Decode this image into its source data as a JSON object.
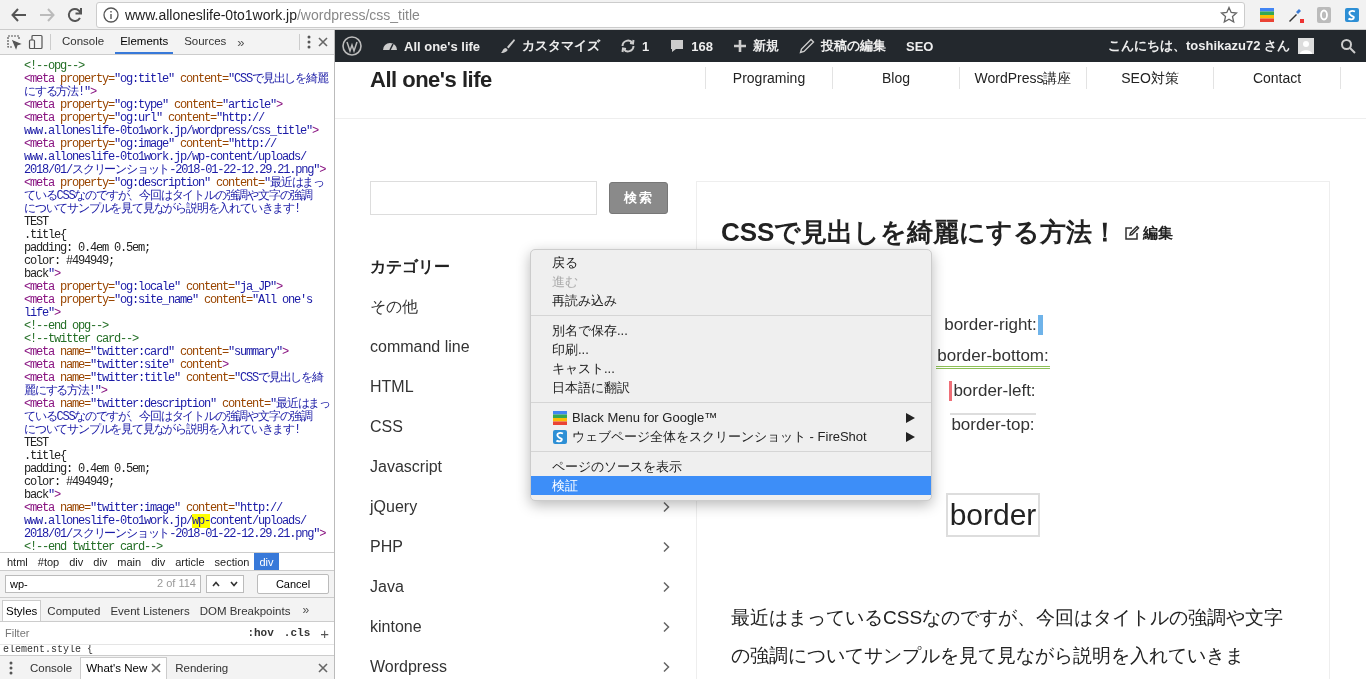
{
  "browser": {
    "url_host": "www.alloneslife-0to1work.jp",
    "url_path": "/wordpress/css_title",
    "back_disabled": false,
    "forward_disabled": true
  },
  "devtools": {
    "tabs": [
      {
        "label": "Console",
        "selected": false
      },
      {
        "label": "Elements",
        "selected": true
      },
      {
        "label": "Sources",
        "selected": false
      }
    ],
    "more": "»",
    "code_lines": [
      [
        {
          "kind": "comment",
          "text": "<!--opg-->"
        }
      ],
      [
        {
          "kind": "tag",
          "text": "<meta "
        },
        {
          "kind": "attr",
          "text": "property="
        },
        {
          "kind": "value",
          "text": "\"og:title\" "
        },
        {
          "kind": "attr",
          "text": "content="
        },
        {
          "kind": "value",
          "text": "\"CSSで見出しを綺麗"
        }
      ],
      [
        {
          "kind": "value",
          "text": "にする方法!\""
        },
        {
          "kind": "tag",
          "text": ">"
        }
      ],
      [
        {
          "kind": "tag",
          "text": "<meta "
        },
        {
          "kind": "attr",
          "text": "property="
        },
        {
          "kind": "value",
          "text": "\"og:type\" "
        },
        {
          "kind": "attr",
          "text": "content="
        },
        {
          "kind": "value",
          "text": "\"article\""
        },
        {
          "kind": "tag",
          "text": ">"
        }
      ],
      [
        {
          "kind": "tag",
          "text": "<meta "
        },
        {
          "kind": "attr",
          "text": "property="
        },
        {
          "kind": "value",
          "text": "\"og:url\" "
        },
        {
          "kind": "attr",
          "text": "content="
        },
        {
          "kind": "value",
          "text": "\"http://"
        }
      ],
      [
        {
          "kind": "value",
          "text": "www.alloneslife-0to1work.jp/wordpress/css_title\""
        },
        {
          "kind": "tag",
          "text": ">"
        }
      ],
      [
        {
          "kind": "tag",
          "text": "<meta "
        },
        {
          "kind": "attr",
          "text": "property="
        },
        {
          "kind": "value",
          "text": "\"og:image\" "
        },
        {
          "kind": "attr",
          "text": "content="
        },
        {
          "kind": "value",
          "text": "\"http://"
        }
      ],
      [
        {
          "kind": "value",
          "text": "www.alloneslife-0to1work.jp/wp-content/uploads/"
        }
      ],
      [
        {
          "kind": "value",
          "text": "2018/01/スクリーンショット-2018-01-22-12.29.21.png\""
        },
        {
          "kind": "tag",
          "text": ">"
        }
      ],
      [
        {
          "kind": "tag",
          "text": "<meta "
        },
        {
          "kind": "attr",
          "text": "property="
        },
        {
          "kind": "value",
          "text": "\"og:description\" "
        },
        {
          "kind": "attr",
          "text": "content="
        },
        {
          "kind": "value",
          "text": "\"最近はまっ"
        }
      ],
      [
        {
          "kind": "value",
          "text": "ているCSSなのですが、今回はタイトルの強調や文字の強調"
        }
      ],
      [
        {
          "kind": "value",
          "text": "についてサンプルを見て見ながら説明を入れていきます!"
        }
      ],
      [
        {
          "kind": "text",
          "text": "TEST"
        }
      ],
      [
        {
          "kind": "text",
          "text": ".title{"
        }
      ],
      [
        {
          "kind": "text",
          "text": "padding: 0.4em 0.5em;"
        }
      ],
      [
        {
          "kind": "text",
          "text": "color: #494949;"
        }
      ],
      [
        {
          "kind": "text",
          "text": "back"
        },
        {
          "kind": "value",
          "text": "\""
        },
        {
          "kind": "tag",
          "text": ">"
        }
      ],
      [
        {
          "kind": "tag",
          "text": "<meta "
        },
        {
          "kind": "attr",
          "text": "property="
        },
        {
          "kind": "value",
          "text": "\"og:locale\" "
        },
        {
          "kind": "attr",
          "text": "content="
        },
        {
          "kind": "value",
          "text": "\"ja_JP\""
        },
        {
          "kind": "tag",
          "text": ">"
        }
      ],
      [
        {
          "kind": "tag",
          "text": "<meta "
        },
        {
          "kind": "attr",
          "text": "property="
        },
        {
          "kind": "value",
          "text": "\"og:site_name\" "
        },
        {
          "kind": "attr",
          "text": "content="
        },
        {
          "kind": "value",
          "text": "\"All one's"
        }
      ],
      [
        {
          "kind": "value",
          "text": "life\""
        },
        {
          "kind": "tag",
          "text": ">"
        }
      ],
      [
        {
          "kind": "comment",
          "text": "<!--end opg-->"
        }
      ],
      [
        {
          "kind": "comment",
          "text": "<!--twitter card-->"
        }
      ],
      [
        {
          "kind": "tag",
          "text": "<meta "
        },
        {
          "kind": "attr",
          "text": "name="
        },
        {
          "kind": "value",
          "text": "\"twitter:card\" "
        },
        {
          "kind": "attr",
          "text": "content="
        },
        {
          "kind": "value",
          "text": "\"summary\""
        },
        {
          "kind": "tag",
          "text": ">"
        }
      ],
      [
        {
          "kind": "tag",
          "text": "<meta "
        },
        {
          "kind": "attr",
          "text": "name="
        },
        {
          "kind": "value",
          "text": "\"twitter:site\" "
        },
        {
          "kind": "attr",
          "text": "content"
        },
        {
          "kind": "tag",
          "text": ">"
        }
      ],
      [
        {
          "kind": "tag",
          "text": "<meta "
        },
        {
          "kind": "attr",
          "text": "name="
        },
        {
          "kind": "value",
          "text": "\"twitter:title\" "
        },
        {
          "kind": "attr",
          "text": "content="
        },
        {
          "kind": "value",
          "text": "\"CSSで見出しを綺"
        }
      ],
      [
        {
          "kind": "value",
          "text": "麗にする方法!\""
        },
        {
          "kind": "tag",
          "text": ">"
        }
      ],
      [
        {
          "kind": "tag",
          "text": "<meta "
        },
        {
          "kind": "attr",
          "text": "name="
        },
        {
          "kind": "value",
          "text": "\"twitter:description\" "
        },
        {
          "kind": "attr",
          "text": "content="
        },
        {
          "kind": "value",
          "text": "\"最近はまっ"
        }
      ],
      [
        {
          "kind": "value",
          "text": "ているCSSなのですが、今回はタイトルの強調や文字の強調"
        }
      ],
      [
        {
          "kind": "value",
          "text": "についてサンプルを見て見ながら説明を入れていきます!"
        }
      ],
      [
        {
          "kind": "text",
          "text": "TEST"
        }
      ],
      [
        {
          "kind": "text",
          "text": ".title{"
        }
      ],
      [
        {
          "kind": "text",
          "text": "padding: 0.4em 0.5em;"
        }
      ],
      [
        {
          "kind": "text",
          "text": "color: #494949;"
        }
      ],
      [
        {
          "kind": "text",
          "text": "back"
        },
        {
          "kind": "value",
          "text": "\""
        },
        {
          "kind": "tag",
          "text": ">"
        }
      ],
      [
        {
          "kind": "tag",
          "text": "<meta "
        },
        {
          "kind": "attr",
          "text": "name="
        },
        {
          "kind": "value",
          "text": "\"twitter:image\" "
        },
        {
          "kind": "attr",
          "text": "content="
        },
        {
          "kind": "value",
          "text": "\"http://"
        }
      ],
      [
        {
          "kind": "value",
          "text": "www.alloneslife-0to1work.jp/"
        },
        {
          "kind": "match",
          "text": "wp-"
        },
        {
          "kind": "value",
          "text": "content/uploads/"
        }
      ],
      [
        {
          "kind": "value",
          "text": "2018/01/スクリーンショット-2018-01-22-12.29.21.png\""
        },
        {
          "kind": "tag",
          "text": ">"
        }
      ],
      [
        {
          "kind": "comment",
          "text": "<!--end twitter card-->"
        }
      ]
    ],
    "breadcrumbs": [
      {
        "label": "html",
        "selected": false
      },
      {
        "label": "#top",
        "selected": false
      },
      {
        "label": "div",
        "selected": false
      },
      {
        "label": "div",
        "selected": false
      },
      {
        "label": "main",
        "selected": false
      },
      {
        "label": "div",
        "selected": false
      },
      {
        "label": "article",
        "selected": false
      },
      {
        "label": "section",
        "selected": false
      },
      {
        "label": "div",
        "selected": true
      }
    ],
    "search": {
      "value": "wp-",
      "count": "2 of 114",
      "cancel": "Cancel"
    },
    "pane_tabs": [
      {
        "label": "Styles",
        "selected": true
      },
      {
        "label": "Computed",
        "selected": false
      },
      {
        "label": "Event Listeners",
        "selected": false
      },
      {
        "label": "DOM Breakpoints",
        "selected": false
      }
    ],
    "pane_more": "»",
    "filter": {
      "placeholder": "Filter",
      "hov": ":hov",
      "cls": ".cls",
      "add": "+"
    },
    "rule_start": "element.style {",
    "drawer_tabs": [
      {
        "label": "Console",
        "selected": false,
        "closable": false
      },
      {
        "label": "What's New",
        "selected": true,
        "closable": true
      },
      {
        "label": "Rendering",
        "selected": false,
        "closable": false
      }
    ]
  },
  "admin_bar": {
    "items": [
      {
        "kind": "wordpress"
      },
      {
        "kind": "dashboard",
        "label": "All one's life"
      },
      {
        "kind": "brush",
        "label": "カスタマイズ"
      },
      {
        "kind": "refresh",
        "label": "1"
      },
      {
        "kind": "comment",
        "label": "168"
      },
      {
        "kind": "plus",
        "label": "新規"
      },
      {
        "kind": "pencil",
        "label": "投稿の編集"
      },
      {
        "kind": "text",
        "label": "SEO"
      }
    ],
    "greeting": "こんにちは、toshikazu72 さん"
  },
  "site": {
    "title": "All one's life",
    "nav": [
      "Programing",
      "Blog",
      "WordPress講座",
      "SEO対策",
      "Contact"
    ]
  },
  "sidebar": {
    "search_button": "検索",
    "heading": "カテゴリー",
    "categories": [
      {
        "label": "その他",
        "arrow": false
      },
      {
        "label": "command line",
        "arrow": false
      },
      {
        "label": "HTML",
        "arrow": false
      },
      {
        "label": "CSS",
        "arrow": false
      },
      {
        "label": "Javascript",
        "arrow": false
      },
      {
        "label": "jQuery",
        "arrow": true
      },
      {
        "label": "PHP",
        "arrow": true
      },
      {
        "label": "Java",
        "arrow": true
      },
      {
        "label": "kintone",
        "arrow": true
      },
      {
        "label": "Wordpress",
        "arrow": true
      }
    ]
  },
  "article": {
    "title": "CSSで見出しを綺麗にする方法！",
    "edit": "編集",
    "samples": [
      {
        "kind": "right",
        "text": "border-right:"
      },
      {
        "kind": "bottom",
        "text": "border-bottom:"
      },
      {
        "kind": "left",
        "text": "border-left:"
      },
      {
        "kind": "top",
        "text": "border-top:"
      }
    ],
    "box_sample": "border",
    "body": "最近はまっているCSSなのですが、今回はタイトルの強調や文字の強調についてサンプルを見て見ながら説明を入れていきま"
  },
  "context_menu": {
    "groups": [
      [
        {
          "label": "戻る",
          "disabled": false,
          "selected": false,
          "submenu": false
        },
        {
          "label": "進む",
          "disabled": true,
          "selected": false,
          "submenu": false
        },
        {
          "label": "再読み込み",
          "disabled": false,
          "selected": false,
          "submenu": false
        }
      ],
      [
        {
          "label": "別名で保存...",
          "disabled": false,
          "selected": false,
          "submenu": false
        },
        {
          "label": "印刷...",
          "disabled": false,
          "selected": false,
          "submenu": false
        },
        {
          "label": "キャスト...",
          "disabled": false,
          "selected": false,
          "submenu": false
        },
        {
          "label": "日本語に翻訳",
          "disabled": false,
          "selected": false,
          "submenu": false
        }
      ],
      [
        {
          "label": "Black Menu for Google™",
          "disabled": false,
          "selected": false,
          "submenu": true,
          "kind": "stripes"
        },
        {
          "label": "ウェブページ全体をスクリーンショット - FireShot",
          "disabled": false,
          "selected": false,
          "submenu": true,
          "kind": "sshot"
        }
      ],
      [
        {
          "label": "ページのソースを表示",
          "disabled": false,
          "selected": false,
          "submenu": false
        },
        {
          "label": "検証",
          "disabled": false,
          "selected": true,
          "submenu": false
        }
      ]
    ]
  }
}
